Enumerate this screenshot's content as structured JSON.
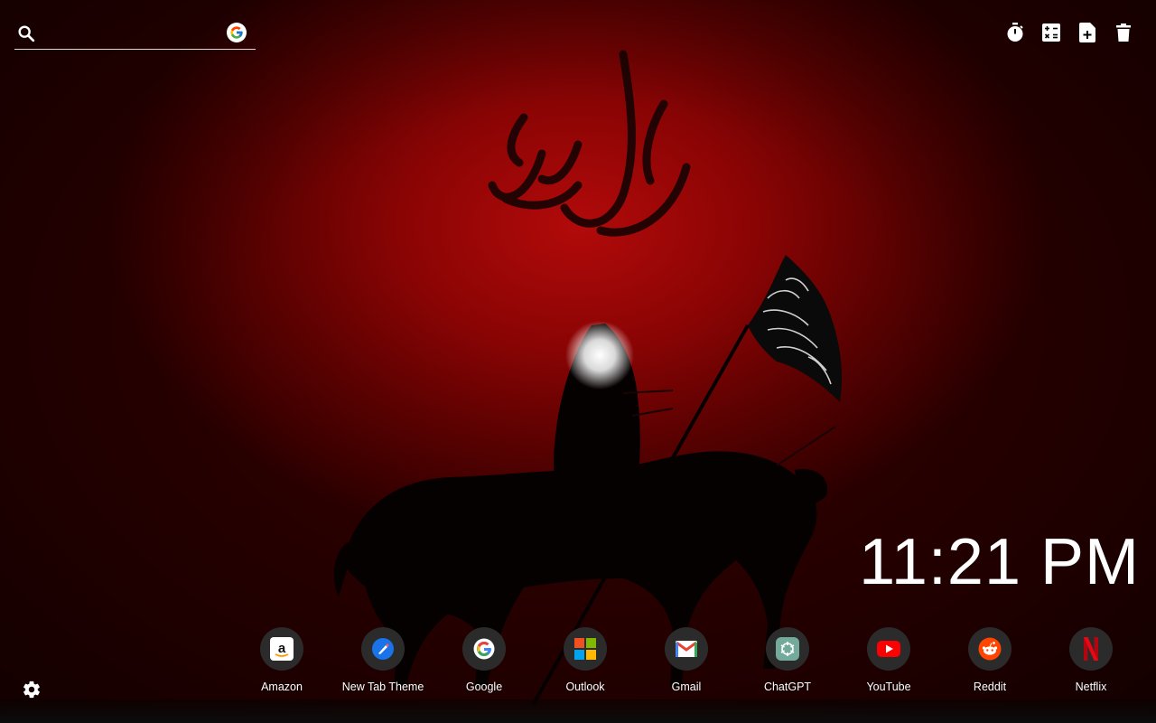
{
  "search": {
    "value": "",
    "placeholder": "",
    "engine_icon": "google-icon"
  },
  "toolbar": {
    "buttons": [
      {
        "icon": "timer-icon"
      },
      {
        "icon": "calculator-icon"
      },
      {
        "icon": "add-note-icon"
      },
      {
        "icon": "trash-icon"
      }
    ]
  },
  "clock": {
    "time": "11:21 PM"
  },
  "shortcuts": [
    {
      "label": "Amazon",
      "icon": "amazon-icon"
    },
    {
      "label": "New Tab Theme",
      "icon": "new-tab-theme-icon"
    },
    {
      "label": "Google",
      "icon": "google-icon"
    },
    {
      "label": "Outlook",
      "icon": "outlook-icon"
    },
    {
      "label": "Gmail",
      "icon": "gmail-icon"
    },
    {
      "label": "ChatGPT",
      "icon": "chatgpt-icon"
    },
    {
      "label": "YouTube",
      "icon": "youtube-icon"
    },
    {
      "label": "Reddit",
      "icon": "reddit-icon"
    },
    {
      "label": "Netflix",
      "icon": "netflix-icon"
    }
  ],
  "settings": {
    "icon": "gear-icon"
  },
  "colors": {
    "background_red": "#8a0404",
    "text": "#ffffff",
    "tile": "#2b2b2b"
  }
}
